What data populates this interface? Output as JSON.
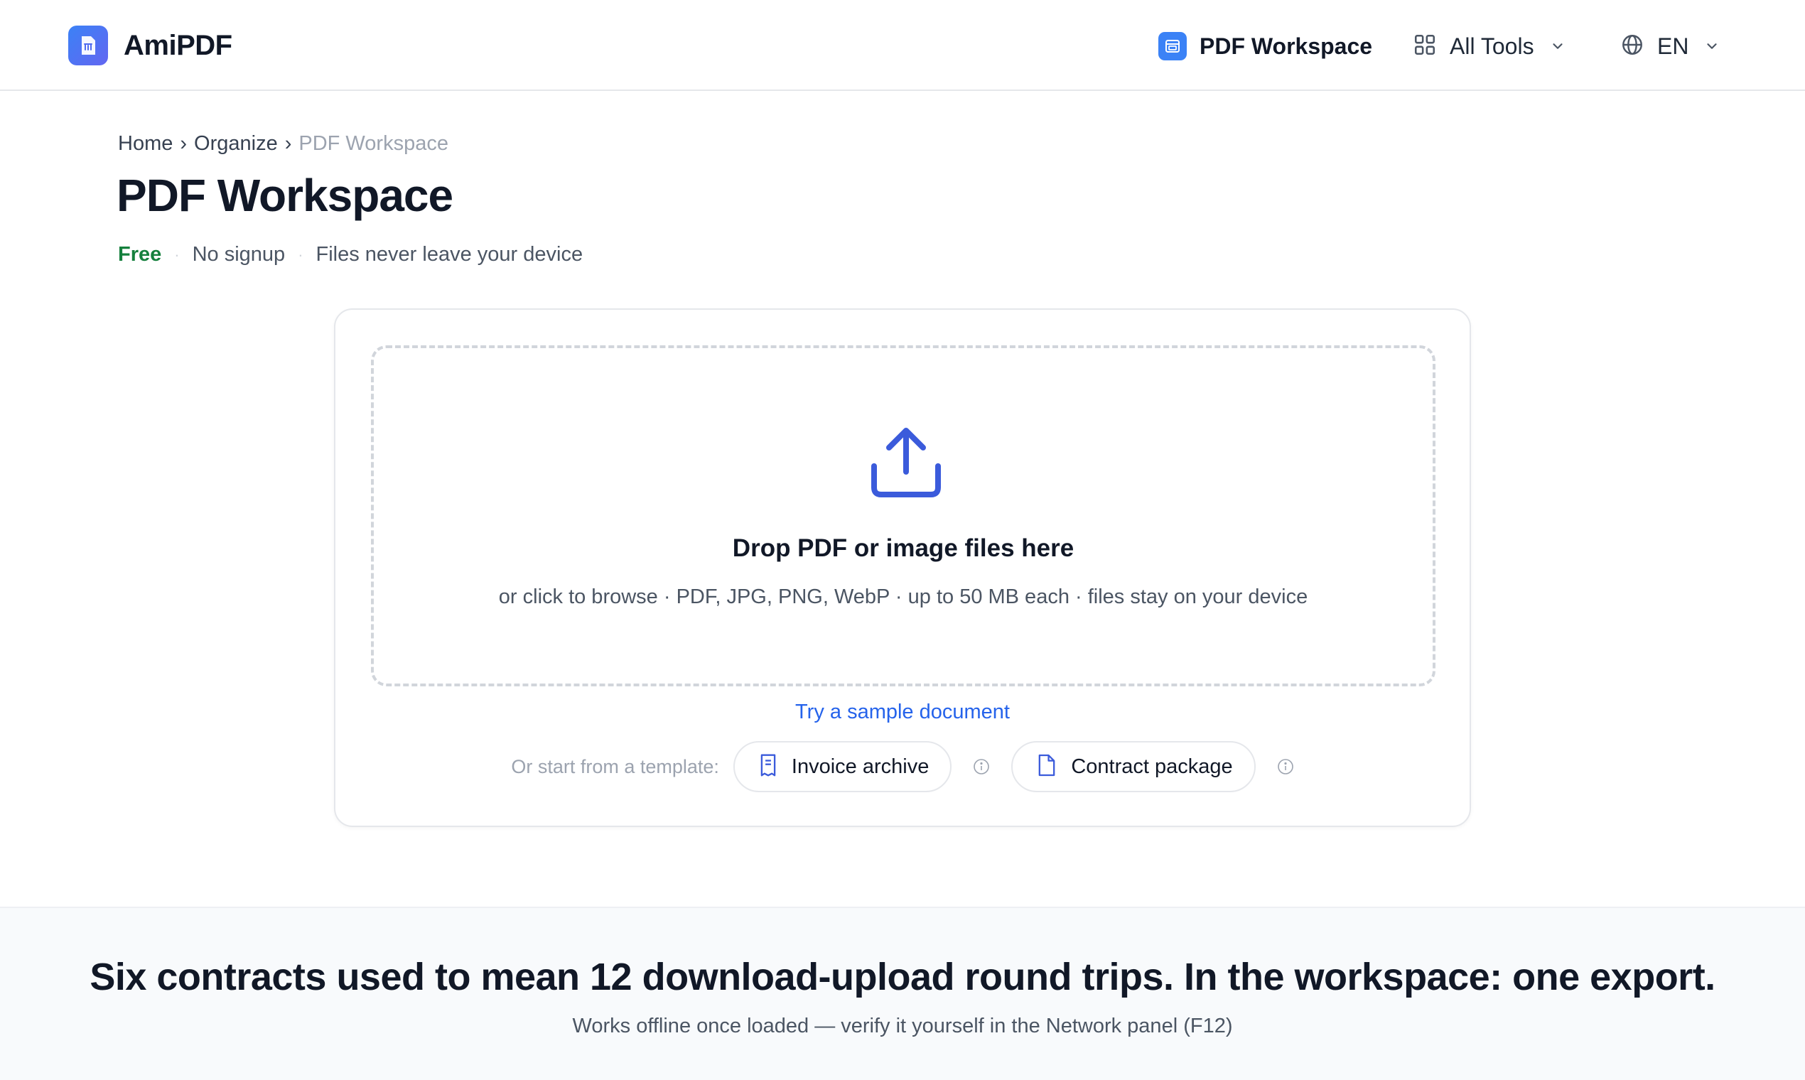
{
  "brand": {
    "name": "AmiPDF",
    "logo_icon": "document-logo-icon",
    "accent": "#3b82f6"
  },
  "nav": {
    "workspace_label": "PDF Workspace",
    "workspace_icon": "workspace-icon",
    "tools_label": "All Tools",
    "tools_icon": "grid-icon",
    "lang_label": "EN",
    "lang_icon": "globe-icon"
  },
  "breadcrumb": {
    "items": [
      "Home",
      "Organize",
      "PDF Workspace"
    ],
    "separator": "›"
  },
  "page": {
    "title": "PDF Workspace",
    "tagline": {
      "free": "Free",
      "no_signup": "No signup",
      "privacy": "Files never leave your device",
      "dot": "·"
    }
  },
  "upload": {
    "icon": "upload-icon",
    "title": "Drop PDF or image files here",
    "subtitle": "or click to browse · PDF, JPG, PNG, WebP · up to 50 MB each · files stay on your device",
    "sample_link": "Try a sample document"
  },
  "templates": {
    "label": "Or start from a template:",
    "items": [
      {
        "label": "Invoice archive",
        "icon": "receipt-icon"
      },
      {
        "label": "Contract package",
        "icon": "document-icon"
      }
    ]
  },
  "promo": {
    "headline": "Six contracts used to mean 12 download-upload round trips. In the workspace: one export.",
    "subline": "Works offline once loaded — verify it yourself in the Network panel (F12)"
  },
  "colors": {
    "link": "#2563eb",
    "free": "#15803d",
    "muted": "#9ca3af",
    "band_bg": "#f8fafc"
  }
}
